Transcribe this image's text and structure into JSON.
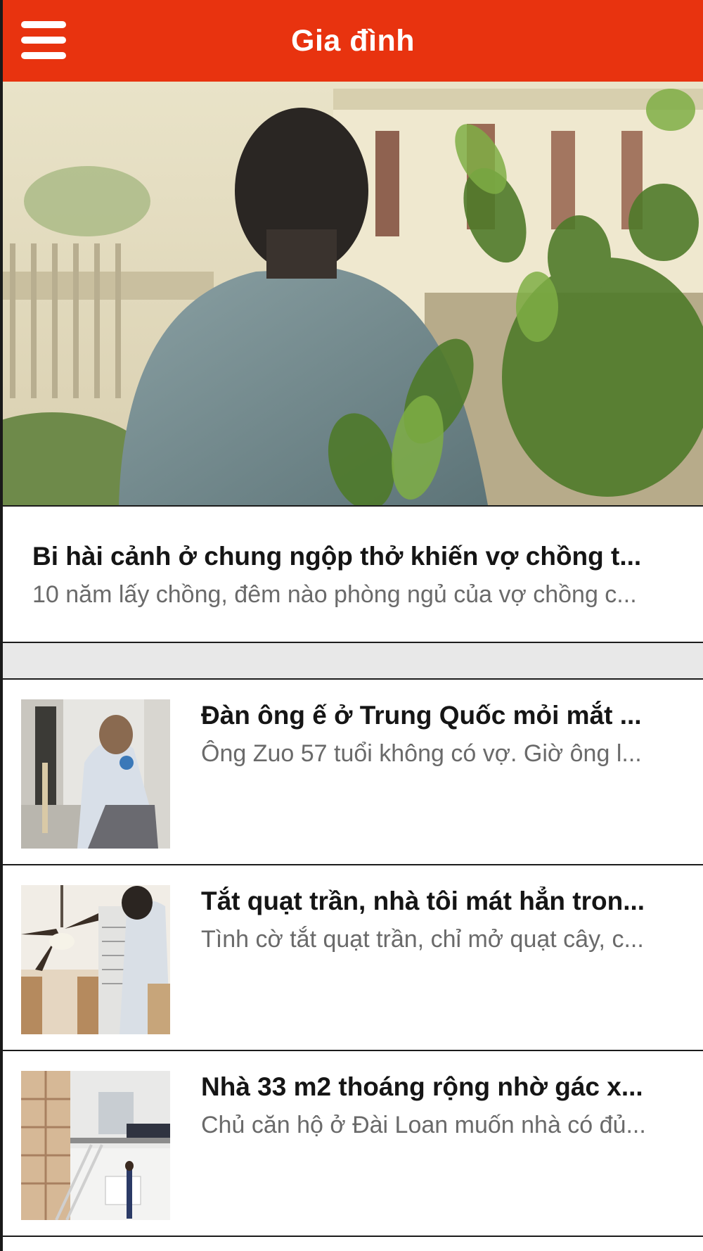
{
  "header": {
    "title": "Gia đình",
    "menu_icon": "hamburger-menu-icon",
    "background_color": "#e8330f"
  },
  "featured": {
    "image_description_icon": "featured-article-photo",
    "title": "Bi hài cảnh ở chung ngộp thở khiến vợ chồng t...",
    "summary": "10 năm lấy chồng, đêm nào phòng ngủ của vợ chồng c..."
  },
  "articles": [
    {
      "title": "Đàn ông ế ở Trung Quốc mỏi mắt ...",
      "summary": "Ông Zuo 57 tuổi không có vợ. Giờ ông l..."
    },
    {
      "title": "Tắt quạt trần, nhà tôi mát hẳn tron...",
      "summary": "Tình cờ tắt quạt trần, chỉ mở quạt cây, c..."
    },
    {
      "title": "Nhà 33 m2 thoáng rộng nhờ gác x...",
      "summary": "Chủ căn hộ ở Đài Loan muốn nhà có đủ..."
    }
  ],
  "colors": {
    "accent": "#e8330f",
    "title_text": "#151515",
    "summary_text": "#6a6a6a",
    "separator_band": "#e8e8e8"
  }
}
